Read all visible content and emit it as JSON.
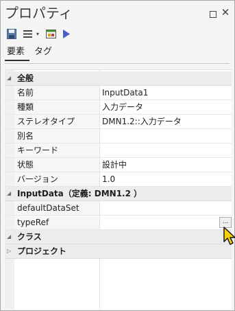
{
  "window": {
    "title": "プロパティ",
    "restore_label": "",
    "close_label": "✕"
  },
  "toolbar": {
    "caret": "▾"
  },
  "tabs": [
    {
      "label": "要素",
      "active": true
    },
    {
      "label": "タグ",
      "active": false
    }
  ],
  "properties": {
    "groups": [
      {
        "label": "全般",
        "expanded": true,
        "rows": [
          {
            "name": "名前",
            "value": "InputData1"
          },
          {
            "name": "種類",
            "value": "入力データ"
          },
          {
            "name": "ステレオタイプ",
            "value": "DMN1.2::入力データ"
          },
          {
            "name": "別名",
            "value": ""
          },
          {
            "name": "キーワード",
            "value": ""
          },
          {
            "name": "状態",
            "value": "設計中"
          },
          {
            "name": "バージョン",
            "value": "1.0"
          }
        ]
      },
      {
        "label": "InputData（定義: DMN1.2 ）",
        "expanded": true,
        "rows": [
          {
            "name": "defaultDataSet",
            "value": ""
          },
          {
            "name": "typeRef",
            "value": "",
            "button": "..."
          }
        ]
      },
      {
        "label": "クラス",
        "expanded": true,
        "rows": []
      },
      {
        "label": "プロジェクト",
        "expanded": false,
        "rows": []
      }
    ]
  },
  "colors": {
    "play_accent": "#4a5fc1",
    "cursor_fill": "#f5d200"
  }
}
